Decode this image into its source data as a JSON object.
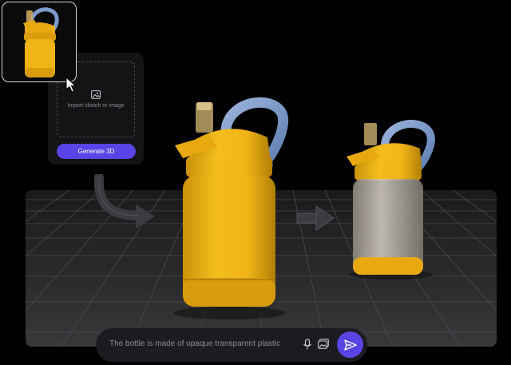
{
  "upload_panel": {
    "dropzone_label": "Import sketch or image",
    "generate_button": "Generate 3D"
  },
  "prompt_bar": {
    "text": "The bottle is made of opaque transparent plastic"
  },
  "icons": {
    "upload": "image-upload-icon",
    "mic": "microphone-icon",
    "image": "image-icon",
    "send": "send-icon",
    "cursor": "mouse-pointer-icon",
    "arrows": "arrow-right-icon"
  },
  "colors": {
    "accent": "#5a44e6",
    "bottle_yellow": "#f0b416",
    "handle_blue": "#7c9ccf",
    "background": "#000000",
    "stage_floor": "#2a2a2c"
  }
}
